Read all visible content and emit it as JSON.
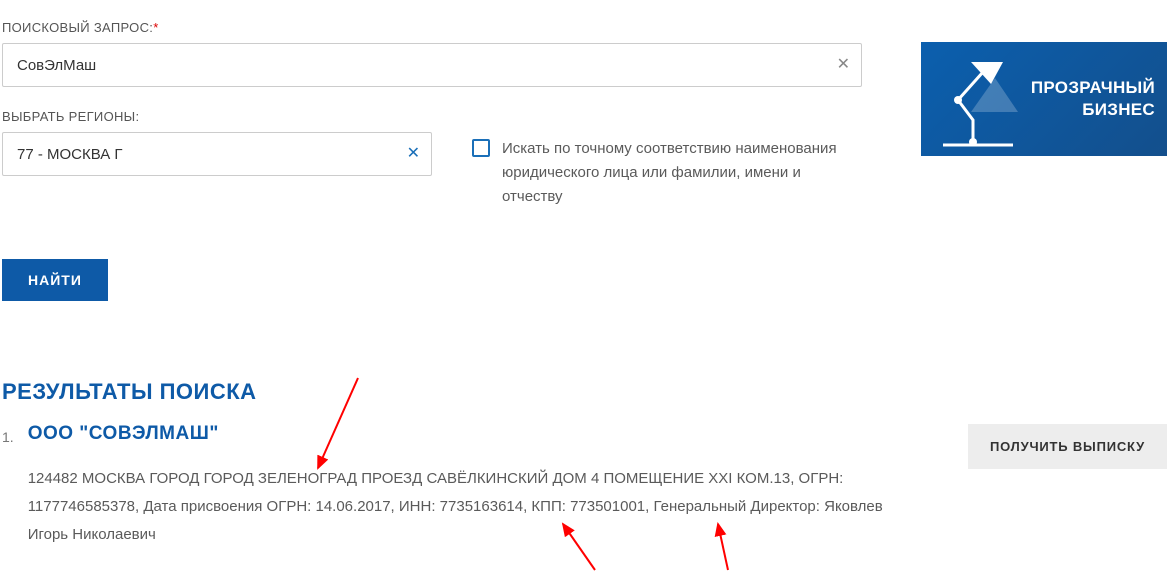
{
  "search": {
    "query_label": "ПОИСКОВЫЙ ЗАПРОС:",
    "required_mark": "*",
    "query_value": "СовЭлМаш",
    "region_label": "ВЫБРАТЬ РЕГИОНЫ:",
    "region_value": "77 - МОСКВА Г",
    "exact_match_label": "Искать по точному соответствию наименования юридического лица или фамилии, имени и отчеству",
    "submit_label": "НАЙТИ"
  },
  "banner": {
    "line1": "ПРОЗРАЧНЫЙ",
    "line2": "БИЗНЕС"
  },
  "results": {
    "heading": "РЕЗУЛЬТАТЫ ПОИСКА",
    "get_extract_label": "ПОЛУЧИТЬ ВЫПИСКУ",
    "items": [
      {
        "num": "1.",
        "title": "ООО \"СОВЭЛМАШ\"",
        "details": "124482 МОСКВА ГОРОД ГОРОД ЗЕЛЕНОГРАД ПРОЕЗД САВЁЛКИНСКИЙ ДОМ 4 ПОМЕЩЕНИЕ XXI КОМ.13, ОГРН: 1177746585378, Дата присвоения ОГРН: 14.06.2017, ИНН: 7735163614, КПП: 773501001, Генеральный Директор: Яковлев Игорь Николаевич"
      }
    ]
  }
}
